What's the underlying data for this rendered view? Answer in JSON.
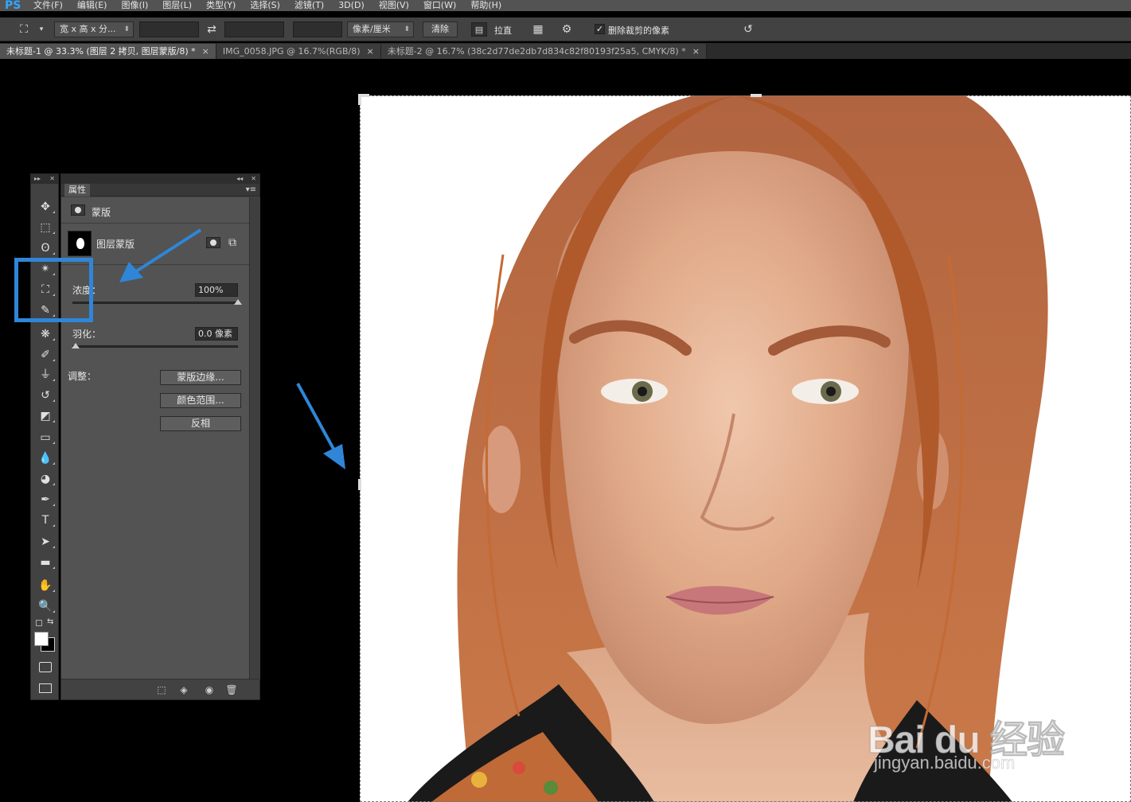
{
  "app": {
    "logo": "PS",
    "menu": [
      "文件(F)",
      "编辑(E)",
      "图像(I)",
      "图层(L)",
      "类型(Y)",
      "选择(S)",
      "滤镜(T)",
      "3D(D)",
      "视图(V)",
      "窗口(W)",
      "帮助(H)"
    ]
  },
  "options_bar": {
    "tool_icon": "crop-icon",
    "ratio_dropdown": "宽 x 高 x 分...",
    "width_value": "",
    "swap_icon": "swap-icon",
    "height_value": "",
    "resolution_value": "",
    "unit_dropdown": "像素/厘米",
    "clear_button": "清除",
    "straighten_label": "拉直",
    "grid_icon": "grid-overlay-icon",
    "settings_icon": "gear-icon",
    "delete_cropped_checked": true,
    "delete_cropped_label": "删除裁剪的像素",
    "reset_icon": "reset-icon"
  },
  "tabs": [
    {
      "label": "未标题-1 @ 33.3% (图层 2 拷贝, 图层蒙版/8) *",
      "active": true
    },
    {
      "label": "IMG_0058.JPG @ 16.7%(RGB/8)",
      "active": false
    },
    {
      "label": "未标题-2 @ 16.7% (38c2d77de2db7d834c82f80193f25a5, CMYK/8) *",
      "active": false
    }
  ],
  "tools": [
    {
      "name": "move-tool",
      "glyph": "✥"
    },
    {
      "name": "marquee-tool",
      "glyph": "⬚"
    },
    {
      "name": "lasso-tool",
      "glyph": "ʘ"
    },
    {
      "name": "magic-wand-tool",
      "glyph": "✴"
    },
    {
      "name": "crop-tool",
      "glyph": "⛶"
    },
    {
      "name": "eyedropper-tool",
      "glyph": "✎"
    },
    {
      "name": "healing-brush-tool",
      "glyph": "❋"
    },
    {
      "name": "brush-tool",
      "glyph": "✐"
    },
    {
      "name": "clone-stamp-tool",
      "glyph": "⏚"
    },
    {
      "name": "history-brush-tool",
      "glyph": "↺"
    },
    {
      "name": "eraser-tool",
      "glyph": "◩"
    },
    {
      "name": "gradient-tool",
      "glyph": "▭"
    },
    {
      "name": "blur-tool",
      "glyph": "💧"
    },
    {
      "name": "dodge-tool",
      "glyph": "◕"
    },
    {
      "name": "pen-tool",
      "glyph": "✒"
    },
    {
      "name": "type-tool",
      "glyph": "T"
    },
    {
      "name": "path-selection-tool",
      "glyph": "➤"
    },
    {
      "name": "rectangle-tool",
      "glyph": "▬"
    },
    {
      "name": "hand-tool",
      "glyph": "✋"
    },
    {
      "name": "zoom-tool",
      "glyph": "🔍"
    }
  ],
  "properties": {
    "tab_label": "属性",
    "section_title": "蒙版",
    "layer_mask_label": "图层蒙版",
    "density_label": "浓度：",
    "density_value": "100%",
    "density_fraction": 1.0,
    "feather_label": "羽化：",
    "feather_value": "0.0 像素",
    "feather_fraction": 0.0,
    "adjust_label": "调整：",
    "buttons": [
      "蒙版边缘...",
      "颜色范围...",
      "反相"
    ]
  },
  "watermark": {
    "brand": "Bai du 经验",
    "url": "jingyan.baidu.com"
  },
  "colors": {
    "highlight": "#2f86d8",
    "ps_blue": "#31a8ff",
    "hair": "#b8582a"
  }
}
